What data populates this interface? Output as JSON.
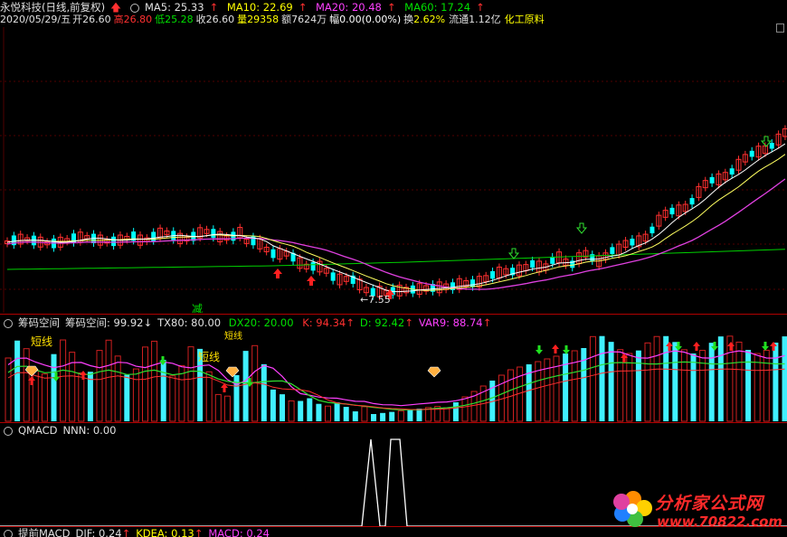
{
  "header": {
    "stock_name": "永悦科技(日线,前复权)",
    "ma5": "MA5: 25.33",
    "ma10": "MA10: 22.69",
    "ma20": "MA20: 20.48",
    "ma60": "MA60: 17.24",
    "date": "2020/05/29/五",
    "open_label": "开",
    "open": "26.60",
    "high_label": "高",
    "high": "26.80",
    "low_label": "低",
    "low": "25.28",
    "close_label": "收",
    "close": "26.60",
    "vol_label": "量",
    "vol": "29358",
    "amount": "额7624万",
    "range": "幅0.00(0.00%)",
    "turnover_label": "换",
    "turnover": "2.62%",
    "float": "流通1.12亿",
    "industry": "化工原料"
  },
  "main_chart": {
    "low_marker": "7.55",
    "reduce_label": "减"
  },
  "mid_panel": {
    "title": "筹码空间",
    "label": "筹码空间: 99.92",
    "tx80": "TX80: 80.00",
    "dx20": "DX20: 20.00",
    "k": "K: 94.34",
    "d": "D: 92.42",
    "var9": "VAR9: 88.74",
    "short_line_1": "短线",
    "short_line_2": "短线",
    "short_line_3": "短线"
  },
  "low_panel": {
    "title": "QMACD",
    "nnn": "NNN: 0.00"
  },
  "bottom_panel": {
    "title": "提前MACD",
    "dif": "DIF: 0.24",
    "kdea": "KDEA: 0.13",
    "macd": "MACD: 0.24"
  },
  "watermark": {
    "name": "分析家公式网",
    "url": "www.70822.com"
  },
  "colors": {
    "up": "#ff3030",
    "down": "#00ffff",
    "ma5": "#ffffff",
    "ma10": "#ffff00",
    "ma20": "#ff40ff",
    "ma60": "#00e000"
  }
}
